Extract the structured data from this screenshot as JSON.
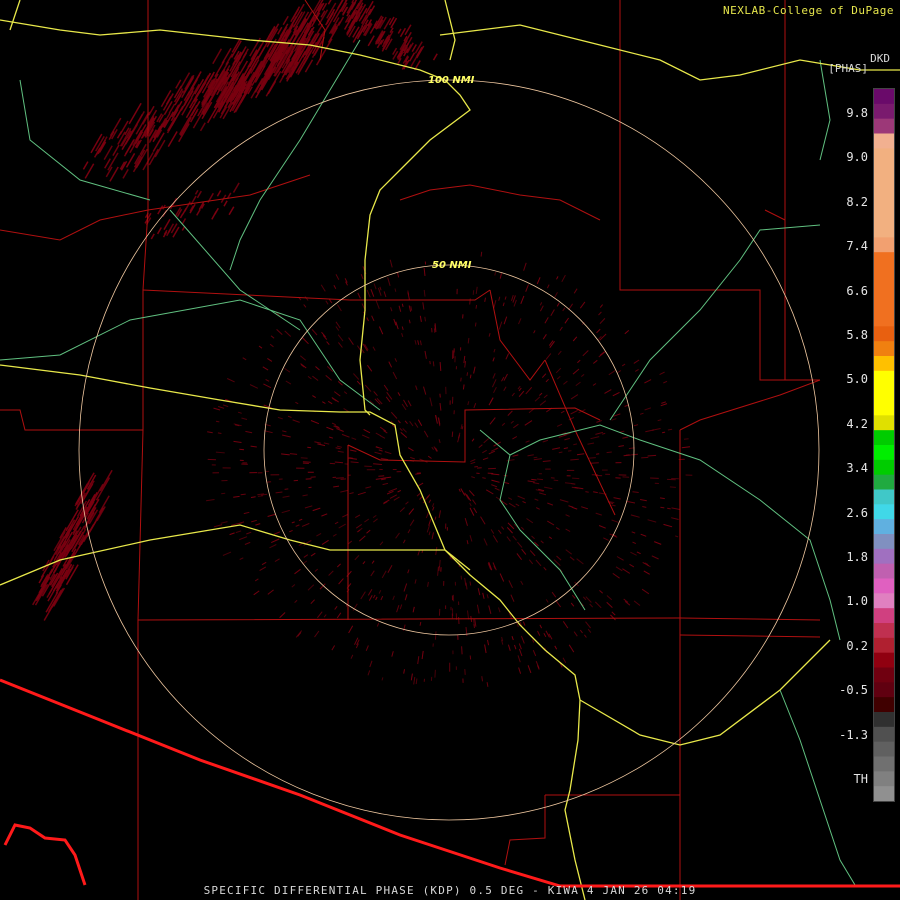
{
  "header": {
    "credit": "NEXLAB-College of DuPage",
    "units_code": "DKD",
    "units_name": "[PHAS]"
  },
  "range_rings": {
    "inner_label": "50 NMI",
    "outer_label": "100 NMI"
  },
  "colorbar": {
    "ticks": [
      "9.8",
      "9.0",
      "8.2",
      "7.4",
      "6.6",
      "5.8",
      "5.0",
      "4.2",
      "3.4",
      "2.6",
      "1.8",
      "1.0",
      "0.2",
      "-0.5",
      "-1.3",
      "TH"
    ],
    "colors": [
      "#6a0a6a",
      "#7a1a6e",
      "#9c3878",
      "#f2b090",
      "#f2b080",
      "#f2b080",
      "#f2b080",
      "#f2b080",
      "#f2b080",
      "#f2b080",
      "#f2a070",
      "#f07020",
      "#f07020",
      "#f07020",
      "#f07020",
      "#f07020",
      "#e86010",
      "#f08010",
      "#ffc000",
      "#ffff00",
      "#ffff00",
      "#ffff00",
      "#e0e000",
      "#00cc00",
      "#00ee00",
      "#00cc00",
      "#20aa40",
      "#40c8c8",
      "#40d8e8",
      "#60b0e0",
      "#8090c0",
      "#a070c0",
      "#c060b0",
      "#e060c0",
      "#e080c0",
      "#d04080",
      "#c03050",
      "#b02030",
      "#900010",
      "#700010",
      "#600010",
      "#400000",
      "#303030",
      "#505050",
      "#606060",
      "#707070",
      "#808080",
      "#909090"
    ]
  },
  "footer": {
    "caption": "SPECIFIC DIFFERENTIAL PHASE (KDP) 0.5 DEG - KIWA 4 JAN 26 04:19"
  },
  "colors": {
    "county_lines": "#b01010",
    "roads": "#e8e84a",
    "rivers": "#60c080",
    "range_ring": "#f0c8a0",
    "border": "#ff1a1a",
    "echo": "#7a0010"
  }
}
